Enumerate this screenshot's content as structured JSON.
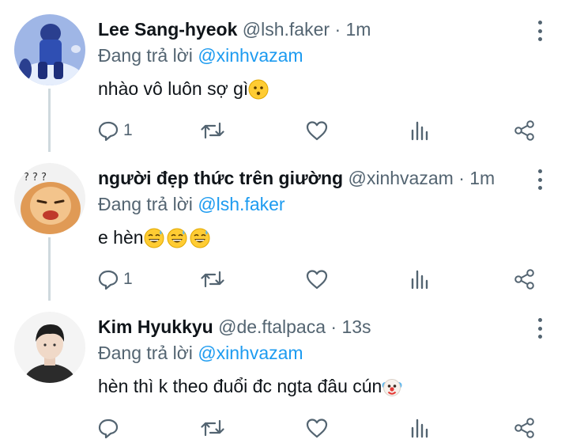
{
  "tweets": [
    {
      "name": "Lee Sang-hyeok",
      "handle": "@lsh.faker",
      "separator": "·",
      "time": "1m",
      "reply_prefix": "Đang trả lời",
      "reply_to": "@xinhvazam",
      "text": "nhào vô luôn sợ gì",
      "emojis": [
        "neutral-face-emoji"
      ],
      "reply_count": "1"
    },
    {
      "name": "người đẹp thức trên giường",
      "handle": "@xinhvazam",
      "separator": "·",
      "time": "1m",
      "reply_prefix": "Đang trả lời",
      "reply_to": "@lsh.faker",
      "text": "e hèn",
      "emojis": [
        "sweat-smile-emoji",
        "sweat-smile-emoji",
        "sweat-smile-emoji"
      ],
      "reply_count": "1"
    },
    {
      "name": "Kim Hyukkyu",
      "handle": "@de.ftalpaca",
      "separator": "·",
      "time": "13s",
      "reply_prefix": "Đang trả lời",
      "reply_to": "@xinhvazam",
      "text": "hèn thì k theo đuổi đc ngta đâu cún",
      "emojis": [
        "clown-face-emoji"
      ],
      "reply_count": ""
    }
  ],
  "icons": [
    "reply-icon",
    "retweet-icon",
    "like-icon",
    "views-icon",
    "share-icon",
    "more-icon"
  ],
  "colors": {
    "mention": "#1d9bf0",
    "secondary_text": "#536471",
    "thread_line": "#cfd9de"
  }
}
